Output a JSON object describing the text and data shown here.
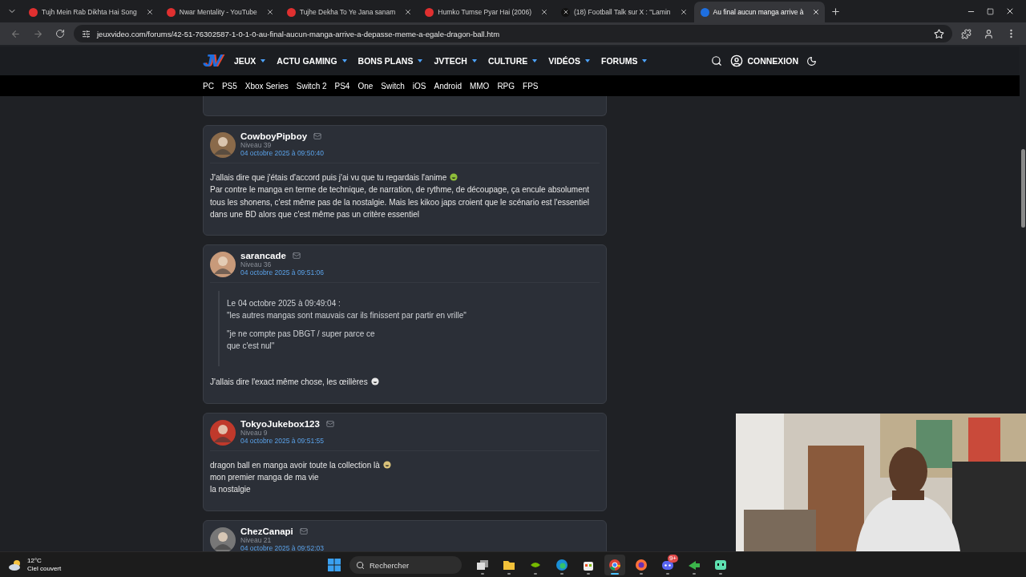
{
  "browser": {
    "tabs": [
      {
        "title": "Tujh Mein Rab Dikhta Hai Song",
        "kind": "youtube",
        "selected": false
      },
      {
        "title": "Nwar Mentality - YouTube",
        "kind": "youtube",
        "selected": false
      },
      {
        "title": "Tujhe Dekha To Ye Jana sanam",
        "kind": "youtube",
        "selected": false
      },
      {
        "title": "Humko Tumse Pyar Hai (2006)",
        "kind": "youtube",
        "selected": false
      },
      {
        "title": "(18) Football Talk sur X : \"Lamin",
        "kind": "x",
        "selected": false
      },
      {
        "title": "Au final aucun manga arrive à",
        "kind": "jv",
        "selected": true
      }
    ],
    "url": "jeuxvideo.com/forums/42-51-76302587-1-0-1-0-au-final-aucun-manga-arrive-a-depasse-meme-a-egale-dragon-ball.htm"
  },
  "site": {
    "logo": "JV",
    "menu": [
      "JEUX",
      "ACTU GAMING",
      "BONS PLANS",
      "JVTECH",
      "CULTURE",
      "VIDÉOS",
      "FORUMS"
    ],
    "login": "CONNEXION",
    "platforms": [
      "PC",
      "PS5",
      "Xbox Series",
      "Switch 2",
      "PS4",
      "One",
      "Switch",
      "iOS",
      "Android",
      "MMO",
      "RPG",
      "FPS"
    ]
  },
  "posts": [
    {
      "author": "CowboyPipboy",
      "level": "Niveau 39",
      "date": "04 octobre 2025 à 09:50:40",
      "lines": [
        {
          "text": "J'allais dire que j'étais d'accord puis j'ai vu que tu regardais l'anime",
          "emoji": true
        },
        {
          "text": "Par contre le manga en terme de technique, de narration, de rythme, de découpage, ça encule absolument tous les shonens, c'est même pas de la nostalgie. Mais les kikoo japs croient que le scénario est l'essentiel dans une BD alors que c'est même pas un critère essentiel"
        }
      ]
    },
    {
      "author": "sarancade",
      "level": "Niveau 36",
      "date": "04 octobre 2025 à 09:51:06",
      "quote": {
        "header": "Le 04 octobre 2025 à 09:49:04 :",
        "paragraphs": [
          "\"les autres mangas sont mauvais car ils finissent par partir en vrille\"",
          "\"je ne compte pas DBGT / super parce ce\nque c'est nul\""
        ]
      },
      "lines": [
        {
          "text": "J'allais dire l'exact même chose, les œillères",
          "emoji": true
        }
      ]
    },
    {
      "author": "TokyoJukebox123",
      "level": "Niveau 9",
      "date": "04 octobre 2025 à 09:51:55",
      "lines": [
        {
          "text": "dragon ball en manga avoir toute la collection là",
          "emoji": true
        },
        {
          "text": "mon premier manga de ma vie"
        },
        {
          "text": "la nostalgie"
        }
      ]
    },
    {
      "author": "ChezCanapi",
      "level": "Niveau 21",
      "date": "04 octobre 2025 à 09:52:03"
    }
  ],
  "taskbar": {
    "weather": {
      "temp": "12°C",
      "sky": "Ciel couvert"
    },
    "search": {
      "placeholder": "Rechercher"
    },
    "apps": [
      {
        "kind": "taskview",
        "selected": false
      },
      {
        "kind": "folder",
        "selected": false
      },
      {
        "kind": "nvidia",
        "selected": false
      },
      {
        "kind": "edge",
        "selected": false
      },
      {
        "kind": "store",
        "selected": false
      },
      {
        "kind": "chrome",
        "selected": true
      },
      {
        "kind": "firefox",
        "selected": false
      },
      {
        "kind": "discord",
        "selected": false,
        "badge": "9+"
      },
      {
        "kind": "arrow",
        "selected": false
      },
      {
        "kind": "bot",
        "selected": false
      }
    ]
  }
}
